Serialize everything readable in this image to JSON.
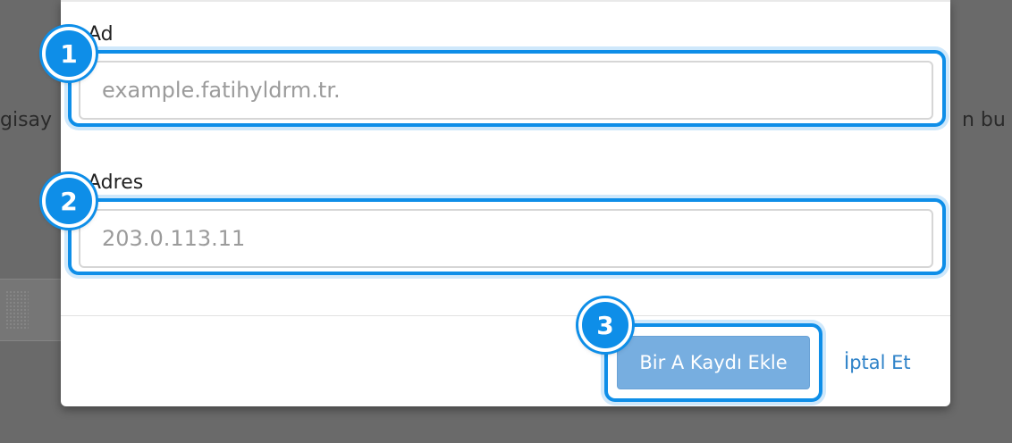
{
  "background": {
    "left_text": "gisay",
    "right_text": "n bu ö"
  },
  "form": {
    "name_label": "Ad",
    "name_placeholder": "example.fatihyldrm.tr.",
    "address_label": "Adres",
    "address_placeholder": "203.0.113.11"
  },
  "actions": {
    "submit_label": "Bir A Kaydı Ekle",
    "cancel_label": "İptal Et"
  },
  "annotations": {
    "badge_1": "1",
    "badge_2": "2",
    "badge_3": "3"
  },
  "colors": {
    "highlight": "#0e8ee8",
    "primary_button": "#77aee0",
    "link": "#2e82c8"
  }
}
